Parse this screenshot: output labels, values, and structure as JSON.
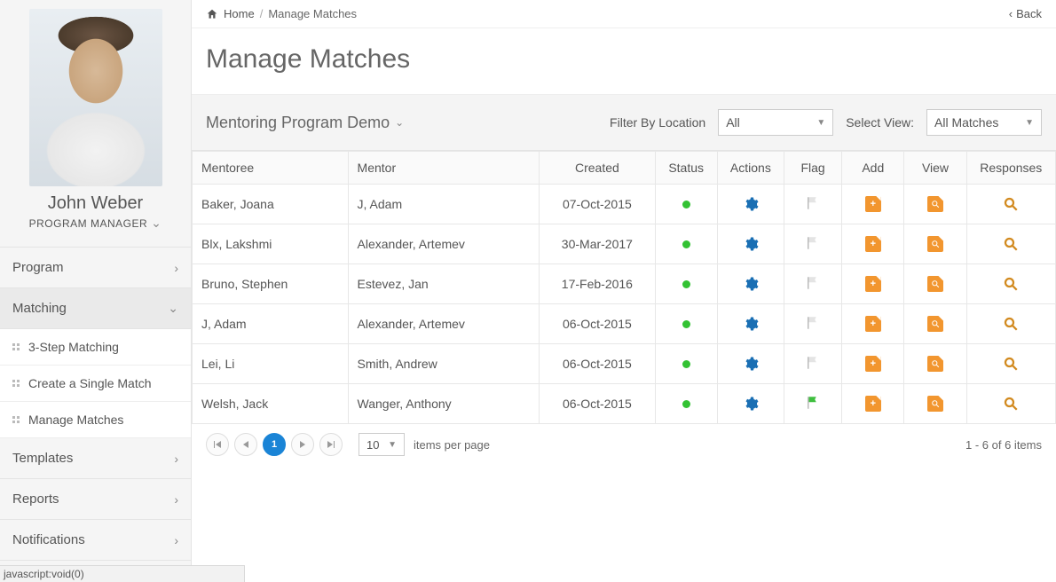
{
  "breadcrumb": {
    "home": "Home",
    "current": "Manage Matches",
    "back": "Back"
  },
  "page": {
    "title": "Manage Matches"
  },
  "profile": {
    "name": "John Weber",
    "role": "PROGRAM MANAGER"
  },
  "sidebar": {
    "items": [
      {
        "label": "Program",
        "expandable": true
      },
      {
        "label": "Matching",
        "expandable": true,
        "expanded": true,
        "children": [
          {
            "label": "3-Step Matching"
          },
          {
            "label": "Create a Single Match"
          },
          {
            "label": "Manage Matches"
          }
        ]
      },
      {
        "label": "Templates",
        "expandable": true
      },
      {
        "label": "Reports",
        "expandable": true
      },
      {
        "label": "Notifications",
        "expandable": true
      }
    ]
  },
  "toolbar": {
    "programName": "Mentoring Program Demo",
    "filterLabel": "Filter By Location",
    "filterValue": "All",
    "viewLabel": "Select View:",
    "viewValue": "All Matches"
  },
  "columns": {
    "mentoree": "Mentoree",
    "mentor": "Mentor",
    "created": "Created",
    "status": "Status",
    "actions": "Actions",
    "flag": "Flag",
    "add": "Add",
    "view": "View",
    "responses": "Responses"
  },
  "rows": [
    {
      "mentoree": "Baker, Joana",
      "mentor": "J, Adam",
      "created": "07-Oct-2015",
      "status": "green",
      "flag": "gray"
    },
    {
      "mentoree": "Blx, Lakshmi",
      "mentor": "Alexander, Artemev",
      "created": "30-Mar-2017",
      "status": "green",
      "flag": "gray"
    },
    {
      "mentoree": "Bruno, Stephen",
      "mentor": "Estevez, Jan",
      "created": "17-Feb-2016",
      "status": "green",
      "flag": "gray"
    },
    {
      "mentoree": "J, Adam",
      "mentor": "Alexander, Artemev",
      "created": "06-Oct-2015",
      "status": "green",
      "flag": "gray"
    },
    {
      "mentoree": "Lei, Li",
      "mentor": "Smith, Andrew",
      "created": "06-Oct-2015",
      "status": "green",
      "flag": "gray"
    },
    {
      "mentoree": "Welsh, Jack",
      "mentor": "Wanger, Anthony",
      "created": "06-Oct-2015",
      "status": "green",
      "flag": "green"
    }
  ],
  "pager": {
    "page": "1",
    "pageSize": "10",
    "perPageLabel": "items per page",
    "summary": "1 - 6 of 6 items"
  },
  "statusHint": "javascript:void(0)"
}
